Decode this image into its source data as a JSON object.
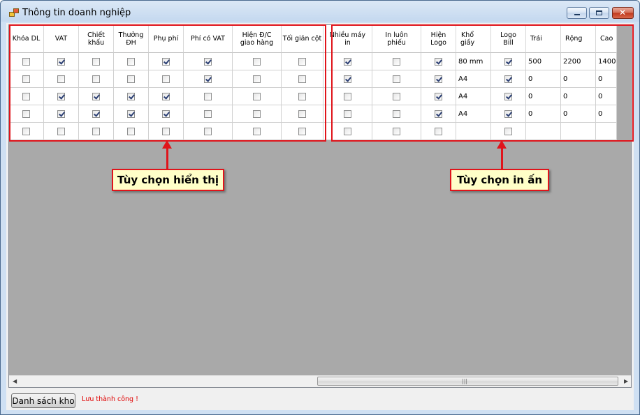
{
  "window": {
    "title": "Thông tin doanh nghiệp"
  },
  "columns": [
    {
      "label": "Khóa DL",
      "kind": "check"
    },
    {
      "label": "VAT",
      "kind": "check"
    },
    {
      "label": "Chiết\nkhấu",
      "kind": "check"
    },
    {
      "label": "Thưởng\nĐH",
      "kind": "check"
    },
    {
      "label": "Phụ phí",
      "kind": "check"
    },
    {
      "label": "Phí có VAT",
      "kind": "check"
    },
    {
      "label": "Hiện Đ/C\ngiao hàng",
      "kind": "check"
    },
    {
      "label": "Tối giản cột",
      "kind": "check"
    },
    {
      "label": "Nhiều máy\nin",
      "kind": "check"
    },
    {
      "label": "In luôn\nphiếu",
      "kind": "check"
    },
    {
      "label": "Hiện\nLogo",
      "kind": "check"
    },
    {
      "label": "Khổ\ngiấy",
      "kind": "text"
    },
    {
      "label": "Logo\nBill",
      "kind": "check"
    },
    {
      "label": "Trái",
      "kind": "text"
    },
    {
      "label": "Rộng",
      "kind": "text"
    },
    {
      "label": "Cao",
      "kind": "text"
    }
  ],
  "rows": [
    [
      false,
      true,
      false,
      false,
      true,
      true,
      false,
      false,
      true,
      false,
      true,
      "80 mm",
      true,
      "500",
      "2200",
      "1400"
    ],
    [
      false,
      false,
      false,
      false,
      false,
      true,
      false,
      false,
      true,
      false,
      true,
      "A4",
      true,
      "0",
      "0",
      "0"
    ],
    [
      false,
      true,
      true,
      true,
      true,
      false,
      false,
      false,
      false,
      false,
      true,
      "A4",
      true,
      "0",
      "0",
      "0"
    ],
    [
      false,
      true,
      true,
      true,
      true,
      false,
      false,
      false,
      false,
      false,
      true,
      "A4",
      true,
      "0",
      "0",
      "0"
    ],
    [
      false,
      false,
      false,
      false,
      false,
      false,
      false,
      false,
      false,
      false,
      false,
      "",
      false,
      "",
      "",
      ""
    ]
  ],
  "annotations": {
    "display_options": "Tùy chọn hiển thị",
    "print_options": "Tùy chọn in ấn"
  },
  "footer": {
    "warehouse_button": "Danh sách kho",
    "status_message": "Lưu thành công !"
  },
  "colors": {
    "annotation": "#e0141b",
    "callout_bg": "#ffffc8",
    "status": "#e00000"
  }
}
